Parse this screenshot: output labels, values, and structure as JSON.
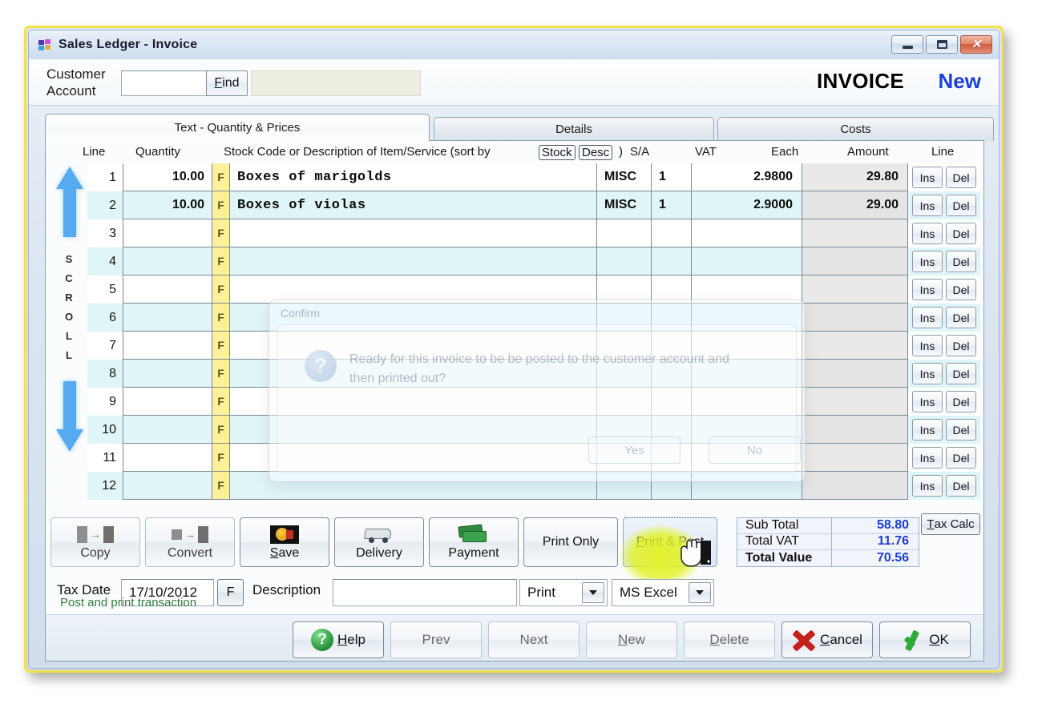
{
  "window": {
    "title": "Sales Ledger  -  Invoice",
    "icon": "windows-flag-icon",
    "minimize_label": "Minimize",
    "maximize_label": "Maximize",
    "close_label": "Close"
  },
  "header": {
    "customer_label_line1": "Customer",
    "customer_label_line2": "Account",
    "account_value": "",
    "find_label": "Find",
    "find_accel": "F",
    "customer_name_value": "",
    "doc_type": "INVOICE",
    "doc_state": "New",
    "doc_state_color": "#1b3fd8"
  },
  "tabs": [
    {
      "label": "Text - Quantity & Prices",
      "active": true
    },
    {
      "label": "Details",
      "active": false
    },
    {
      "label": "Costs",
      "active": false
    }
  ],
  "scroll": {
    "word": "SCROLL",
    "up_icon": "arrow-up-icon",
    "down_icon": "arrow-down-icon",
    "color": "#56aaf0"
  },
  "grid": {
    "headers": {
      "line": "Line",
      "quantity": "Quantity",
      "description_prefix": "Stock Code or Description of Item/Service (sort by",
      "sort_stock": "Stock",
      "sort_desc": "Desc",
      "description_suffix": ")",
      "sa": "S/A",
      "vat": "VAT",
      "each": "Each",
      "amount": "Amount",
      "line_right": "Line"
    },
    "flag_letter": "F",
    "ins_label": "Ins",
    "del_label": "Del",
    "rows": [
      {
        "line": "1",
        "qty": "10.00",
        "desc": "Boxes of marigolds",
        "sa": "MISC",
        "vat": "1",
        "each": "2.9800",
        "amount": "29.80"
      },
      {
        "line": "2",
        "qty": "10.00",
        "desc": "Boxes of violas",
        "sa": "MISC",
        "vat": "1",
        "each": "2.9000",
        "amount": "29.00"
      },
      {
        "line": "3",
        "qty": "",
        "desc": "",
        "sa": "",
        "vat": "",
        "each": "",
        "amount": ""
      },
      {
        "line": "4",
        "qty": "",
        "desc": "",
        "sa": "",
        "vat": "",
        "each": "",
        "amount": ""
      },
      {
        "line": "5",
        "qty": "",
        "desc": "",
        "sa": "",
        "vat": "",
        "each": "",
        "amount": ""
      },
      {
        "line": "6",
        "qty": "",
        "desc": "",
        "sa": "",
        "vat": "",
        "each": "",
        "amount": ""
      },
      {
        "line": "7",
        "qty": "",
        "desc": "",
        "sa": "",
        "vat": "",
        "each": "",
        "amount": ""
      },
      {
        "line": "8",
        "qty": "",
        "desc": "",
        "sa": "",
        "vat": "",
        "each": "",
        "amount": ""
      },
      {
        "line": "9",
        "qty": "",
        "desc": "",
        "sa": "",
        "vat": "",
        "each": "",
        "amount": ""
      },
      {
        "line": "10",
        "qty": "",
        "desc": "",
        "sa": "",
        "vat": "",
        "each": "",
        "amount": ""
      },
      {
        "line": "11",
        "qty": "",
        "desc": "",
        "sa": "",
        "vat": "",
        "each": "",
        "amount": ""
      },
      {
        "line": "12",
        "qty": "",
        "desc": "",
        "sa": "",
        "vat": "",
        "each": "",
        "amount": ""
      }
    ]
  },
  "confirm_dialog": {
    "title": "Confirm",
    "icon": "question-icon",
    "message": "Ready for this invoice to be be posted to the customer account and then printed out?",
    "yes_label": "Yes",
    "no_label": "No",
    "state": "faded"
  },
  "toolbar": [
    {
      "label": "Copy",
      "accel": "",
      "icon": "copy-icon",
      "enabled": false
    },
    {
      "label": "Convert",
      "accel": "",
      "icon": "convert-icon",
      "enabled": false
    },
    {
      "label": "Save",
      "accel": "S",
      "icon": "save-icon",
      "enabled": true
    },
    {
      "label": "Delivery",
      "accel": "",
      "icon": "delivery-icon",
      "enabled": true
    },
    {
      "label": "Payment",
      "accel": "",
      "icon": "payment-icon",
      "enabled": true
    },
    {
      "label": "Print Only",
      "accel": "",
      "icon": "",
      "enabled": true
    },
    {
      "label": "Print & Post",
      "accel": "P",
      "icon": "",
      "enabled": true,
      "focused": true,
      "highlighted": true
    }
  ],
  "cursor": {
    "type": "hand-pointer-cursor",
    "over": "Print & Post"
  },
  "totals": {
    "rows": [
      {
        "label": "Sub Total",
        "value": "58.80",
        "bold": false
      },
      {
        "label": "Total VAT",
        "value": "11.76",
        "bold": false
      },
      {
        "label": "Total Value",
        "value": "70.56",
        "bold": true
      }
    ],
    "value_color": "#1b3fd8",
    "tax_calc_label": "Tax Calc",
    "tax_calc_accel": "T"
  },
  "date_row": {
    "tax_date_label": "Tax Date",
    "tax_date_value": "17/10/2012",
    "date_flag_label": "F",
    "description_label": "Description",
    "description_value": "",
    "print_select_value": "Print",
    "format_select_value": "MS Excel"
  },
  "status": {
    "text": "Post and print transaction",
    "color": "#2f7d3f"
  },
  "bottom_buttons": [
    {
      "label": "Help",
      "accel": "H",
      "icon": "help-icon",
      "enabled": true
    },
    {
      "label": "Prev",
      "accel": "",
      "icon": "",
      "enabled": false
    },
    {
      "label": "Next",
      "accel": "",
      "icon": "",
      "enabled": false
    },
    {
      "label": "New",
      "accel": "N",
      "icon": "",
      "enabled": false
    },
    {
      "label": "Delete",
      "accel": "D",
      "icon": "",
      "enabled": false
    },
    {
      "label": "Cancel",
      "accel": "C",
      "icon": "cancel-icon",
      "enabled": true
    },
    {
      "label": "OK",
      "accel": "O",
      "icon": "ok-icon",
      "enabled": true
    }
  ]
}
